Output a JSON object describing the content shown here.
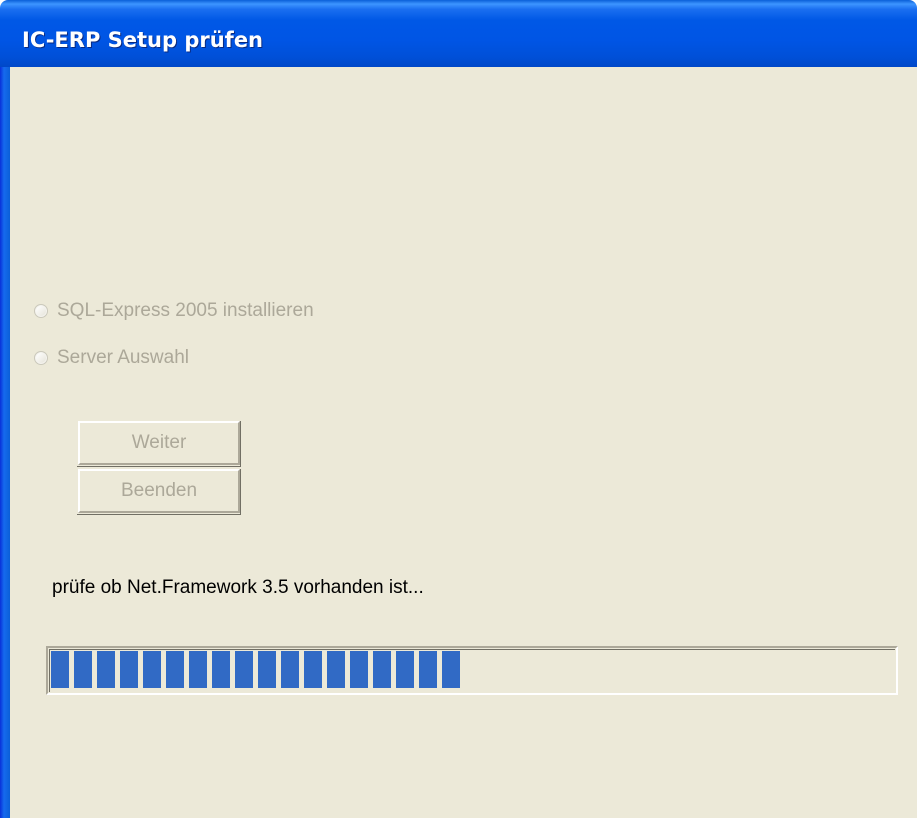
{
  "window": {
    "title": "IC-ERP Setup prüfen"
  },
  "options": [
    {
      "label": "SQL-Express 2005 installieren",
      "enabled": false,
      "selected": false
    },
    {
      "label": "Server Auswahl",
      "enabled": false,
      "selected": false
    }
  ],
  "buttons": {
    "next_label": "Weiter",
    "exit_label": "Beenden"
  },
  "status": {
    "message": "prüfe ob Net.Framework 3.5 vorhanden ist..."
  },
  "progress": {
    "percent": 49,
    "accent_color": "#316ac5"
  },
  "colors": {
    "titlebar": "#0055e5",
    "client_background": "#ece9d8",
    "disabled_text": "#aca899"
  }
}
